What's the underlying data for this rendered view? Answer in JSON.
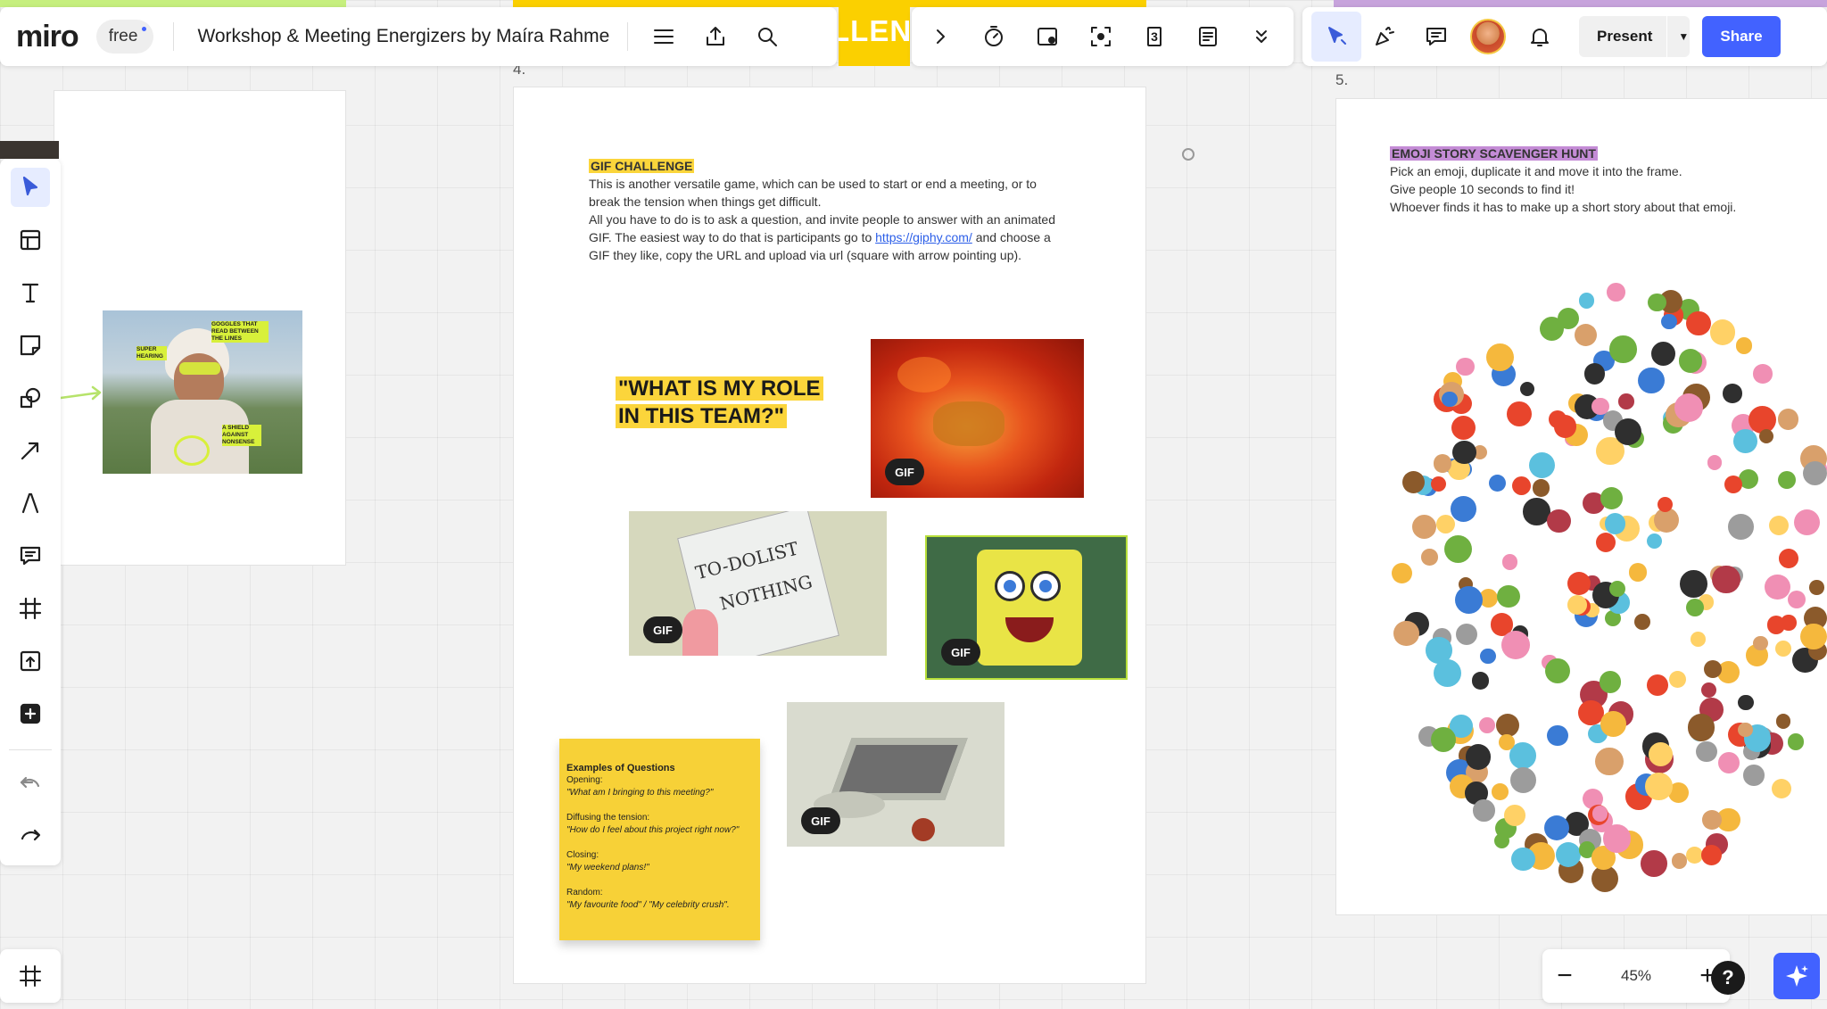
{
  "app": {
    "logo": "miro",
    "plan_badge": "free",
    "board_title": "Workshop & Meeting Energizers by Maíra Rahme"
  },
  "toolbar": {
    "menu_icon": "hamburger-menu-icon",
    "export_icon": "upload-icon",
    "search_icon": "search-icon",
    "collapse_icon": "chevron-right-icon",
    "timer_icon": "timer-icon",
    "card_icon": "card-icon",
    "focus_icon": "focus-icon",
    "counter_value": "3",
    "notes_icon": "notes-icon",
    "more_icon": "chevron-double-down-icon",
    "present_label": "Present",
    "share_label": "Share"
  },
  "frames": {
    "frame4_number": "4.",
    "frame5_number": "5.",
    "banner_fragment": "LLENG"
  },
  "gif_challenge": {
    "title": "GIF CHALLENGE",
    "para1": "This is another versatile game, which can be used to start or end a meeting, or to break the tension when things get difficult.",
    "para2_a": "All you have to do is to ask a question, and invite people to answer with an animated GIF. The easiest way to do that is participants go to ",
    "link": "https://giphy.com/",
    "para2_b": " and choose a GIF they like, copy the URL and upload via url (square with arrow pointing up).",
    "question_line1": "\"WHAT IS MY ROLE",
    "question_line2": "IN THIS TEAM?\"",
    "gif_label": "GIF",
    "todo_line1": "TO-DOLIST",
    "todo_line2": "NOTHING"
  },
  "sticky": {
    "title": "Examples of Questions",
    "opening_label": "Opening:",
    "opening_q": "\"What am I bringing to this meeting?\"",
    "diffusing_label": "Diffusing the tension:",
    "diffusing_q": "\"How do I feel about this project right now?\"",
    "closing_label": "Closing:",
    "closing_q": "\"My weekend plans!\"",
    "random_label": "Random:",
    "random_q": "\"My favourite food\" / \"My celebrity crush\"."
  },
  "emoji_hunt": {
    "title": "EMOJI STORY SCAVENGER HUNT",
    "line1": "Pick an emoji, duplicate it and move it into the frame.",
    "line2": "Give people 10 seconds to find it!",
    "line3": "Whoever finds it has to make up a short story about that emoji."
  },
  "photo_annotations": {
    "goggles": "GOGGLES THAT READ BETWEEN THE LINES",
    "hearing": "SUPER HEARING",
    "shield": "A SHIELD AGAINST NONSENSE"
  },
  "zoom": {
    "level": "45%",
    "help": "?"
  },
  "colors": {
    "accent_blue": "#4262ff",
    "highlight_yellow": "#fbd53b",
    "highlight_purple": "#c48cd6",
    "stripe_green": "#c6ef7e",
    "stripe_yellow": "#fbd000",
    "stripe_purple": "#c7a3dc"
  }
}
